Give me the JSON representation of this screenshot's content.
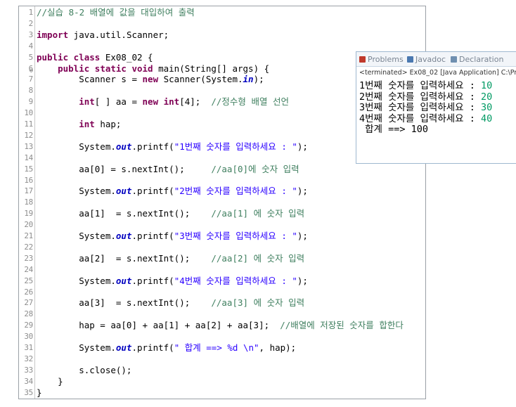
{
  "editor": {
    "lines": [
      {
        "n": "1",
        "segs": [
          {
            "t": "//실습 8-2 배열에 값을 대입하여 출력",
            "c": "cm"
          }
        ]
      },
      {
        "n": "2",
        "segs": []
      },
      {
        "n": "3",
        "segs": [
          {
            "t": "import",
            "c": "kw"
          },
          {
            "t": " java.util.Scanner;",
            "c": ""
          }
        ]
      },
      {
        "n": "4",
        "segs": []
      },
      {
        "n": "5",
        "segs": [
          {
            "t": "public class",
            "c": "kw"
          },
          {
            "t": " Ex08_02 {",
            "c": ""
          }
        ]
      },
      {
        "n": "6",
        "fold": true,
        "segs": [
          {
            "t": "    ",
            "c": ""
          },
          {
            "t": "public static void",
            "c": "kw"
          },
          {
            "t": " main(String[] args) {",
            "c": ""
          }
        ]
      },
      {
        "n": "7",
        "segs": [
          {
            "t": "        Scanner s = ",
            "c": ""
          },
          {
            "t": "new",
            "c": "kw"
          },
          {
            "t": " Scanner(System.",
            "c": ""
          },
          {
            "t": "in",
            "c": "fld"
          },
          {
            "t": ");",
            "c": ""
          }
        ]
      },
      {
        "n": "8",
        "segs": []
      },
      {
        "n": "9",
        "segs": [
          {
            "t": "        ",
            "c": ""
          },
          {
            "t": "int",
            "c": "kw"
          },
          {
            "t": "[ ] aa = ",
            "c": ""
          },
          {
            "t": "new int",
            "c": "kw"
          },
          {
            "t": "[4];  ",
            "c": ""
          },
          {
            "t": "//정수형 배열 선언",
            "c": "cm"
          }
        ]
      },
      {
        "n": "10",
        "segs": []
      },
      {
        "n": "11",
        "segs": [
          {
            "t": "        ",
            "c": ""
          },
          {
            "t": "int",
            "c": "kw"
          },
          {
            "t": " hap;",
            "c": ""
          }
        ]
      },
      {
        "n": "12",
        "segs": []
      },
      {
        "n": "13",
        "segs": [
          {
            "t": "        System.",
            "c": ""
          },
          {
            "t": "out",
            "c": "fld"
          },
          {
            "t": ".printf(",
            "c": ""
          },
          {
            "t": "\"1번째 숫자를 입력하세요 : \"",
            "c": "st"
          },
          {
            "t": ");",
            "c": ""
          }
        ]
      },
      {
        "n": "14",
        "segs": []
      },
      {
        "n": "15",
        "segs": [
          {
            "t": "        aa[0] = s.nextInt();     ",
            "c": ""
          },
          {
            "t": "//aa[0]에 숫자 입력",
            "c": "cm"
          }
        ]
      },
      {
        "n": "16",
        "segs": []
      },
      {
        "n": "17",
        "segs": [
          {
            "t": "        System.",
            "c": ""
          },
          {
            "t": "out",
            "c": "fld"
          },
          {
            "t": ".printf(",
            "c": ""
          },
          {
            "t": "\"2번째 숫자를 입력하세요 : \"",
            "c": "st"
          },
          {
            "t": ");",
            "c": ""
          }
        ]
      },
      {
        "n": "18",
        "segs": []
      },
      {
        "n": "19",
        "segs": [
          {
            "t": "        aa[1]  = s.nextInt();    ",
            "c": ""
          },
          {
            "t": "//aa[1] 에 숫자 입력",
            "c": "cm"
          }
        ]
      },
      {
        "n": "20",
        "segs": []
      },
      {
        "n": "21",
        "segs": [
          {
            "t": "        System.",
            "c": ""
          },
          {
            "t": "out",
            "c": "fld"
          },
          {
            "t": ".printf(",
            "c": ""
          },
          {
            "t": "\"3번째 숫자를 입력하세요 : \"",
            "c": "st"
          },
          {
            "t": ");",
            "c": ""
          }
        ]
      },
      {
        "n": "22",
        "segs": []
      },
      {
        "n": "23",
        "segs": [
          {
            "t": "        aa[2]  = s.nextInt();    ",
            "c": ""
          },
          {
            "t": "//aa[2] 에 숫자 입력",
            "c": "cm"
          }
        ]
      },
      {
        "n": "24",
        "segs": []
      },
      {
        "n": "25",
        "segs": [
          {
            "t": "        System.",
            "c": ""
          },
          {
            "t": "out",
            "c": "fld"
          },
          {
            "t": ".printf(",
            "c": ""
          },
          {
            "t": "\"4번째 숫자를 입력하세요 : \"",
            "c": "st"
          },
          {
            "t": ");",
            "c": ""
          }
        ]
      },
      {
        "n": "26",
        "segs": []
      },
      {
        "n": "27",
        "segs": [
          {
            "t": "        aa[3]  = s.nextInt();    ",
            "c": ""
          },
          {
            "t": "//aa[3] 에 숫자 입력",
            "c": "cm"
          }
        ]
      },
      {
        "n": "28",
        "segs": []
      },
      {
        "n": "29",
        "segs": [
          {
            "t": "        hap = aa[0] + aa[1] + aa[2] + aa[3];  ",
            "c": ""
          },
          {
            "t": "//배열에 저장된 숫자를 합한다",
            "c": "cm"
          }
        ]
      },
      {
        "n": "30",
        "segs": []
      },
      {
        "n": "31",
        "segs": [
          {
            "t": "        System.",
            "c": ""
          },
          {
            "t": "out",
            "c": "fld"
          },
          {
            "t": ".printf(",
            "c": ""
          },
          {
            "t": "\" 합계 ==> %d \\n\"",
            "c": "st"
          },
          {
            "t": ", hap);",
            "c": ""
          }
        ]
      },
      {
        "n": "32",
        "segs": []
      },
      {
        "n": "33",
        "segs": [
          {
            "t": "        s.close();",
            "c": ""
          }
        ]
      },
      {
        "n": "34",
        "segs": [
          {
            "t": "    }",
            "c": ""
          }
        ]
      },
      {
        "n": "35",
        "segs": [
          {
            "t": "}",
            "c": ""
          }
        ]
      }
    ]
  },
  "console": {
    "tabs": [
      {
        "label": "Problems",
        "icon": "problems-icon",
        "color": "#c0392b"
      },
      {
        "label": "Javadoc",
        "icon": "javadoc-icon",
        "color": "#4a78b0"
      },
      {
        "label": "Declaration",
        "icon": "declaration-icon",
        "color": "#6f8fb0"
      }
    ],
    "status": "<terminated> Ex08_02 [Java Application] C:\\Pr",
    "output": [
      {
        "prompt": "1번째 숫자를 입력하세요 : ",
        "input": "10"
      },
      {
        "prompt": "2번째 숫자를 입력하세요 : ",
        "input": "20"
      },
      {
        "prompt": "3번째 숫자를 입력하세요 : ",
        "input": "30"
      },
      {
        "prompt": "4번째 숫자를 입력하세요 : ",
        "input": "40"
      },
      {
        "prompt": " 합계 ==> 100",
        "input": ""
      }
    ]
  },
  "colors": {
    "input_green": "#009a63",
    "keyword": "#7f0055",
    "comment": "#3f7f5f",
    "string": "#2a00ff"
  }
}
